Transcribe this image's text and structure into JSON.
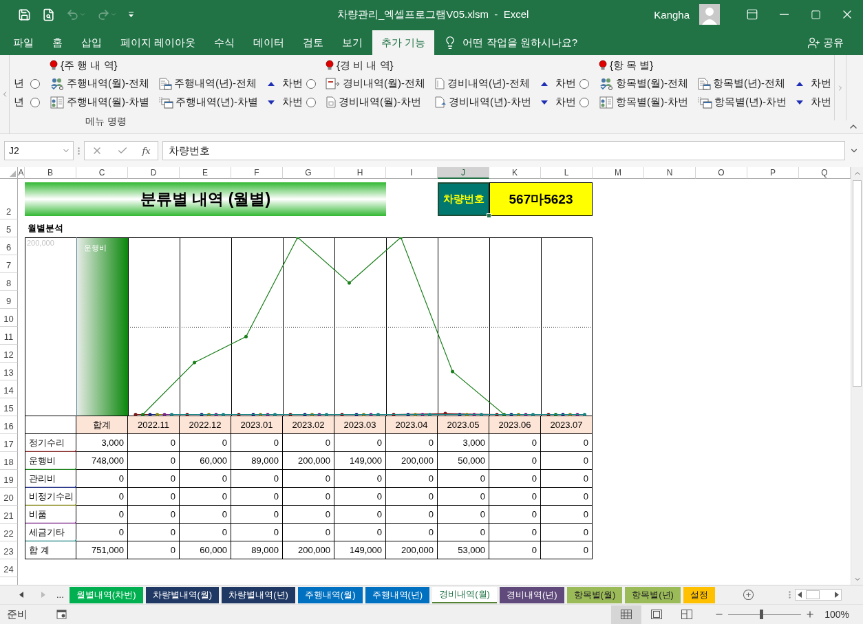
{
  "title_bar": {
    "quick_access": {
      "undo": {
        "disabled": true
      },
      "redo": {
        "disabled": true
      }
    },
    "title": "차량관리_엑셀프로그램V05.xlsm  -  Excel",
    "user": "Kangha"
  },
  "ribbon_tabs": [
    {
      "label": "파일",
      "selected": false
    },
    {
      "label": "홈",
      "selected": false
    },
    {
      "label": "삽입",
      "selected": false
    },
    {
      "label": "페이지 레이아웃",
      "selected": false
    },
    {
      "label": "수식",
      "selected": false
    },
    {
      "label": "데이터",
      "selected": false
    },
    {
      "label": "검토",
      "selected": false
    },
    {
      "label": "보기",
      "selected": false
    },
    {
      "label": "추가 기능",
      "selected": true
    }
  ],
  "tell_me": "어떤 작업을 원하시나요?",
  "share": "공유",
  "ribbon": {
    "cut_left_labels": [
      "년",
      "년"
    ],
    "groups": [
      {
        "header": "{주 행 내 역}",
        "rows": [
          [
            "주행내역(월)-전체",
            "주행내역(년)-전체",
            "차번"
          ],
          [
            "주행내역(월)-차별",
            "주행내역(년)-차별",
            "차번"
          ]
        ]
      },
      {
        "header": "{경 비 내 역}",
        "rows": [
          [
            "경비내역(월)-전체",
            "경비내역(년)-전체",
            "차번"
          ],
          [
            "경비내역(월)-차번",
            "경비내역(년)-차번",
            "차번"
          ]
        ]
      },
      {
        "header": "{항 목 별}",
        "rows": [
          [
            "항목별(월)-전체",
            "항목별(년)-전체",
            "차번"
          ],
          [
            "항목별(월)-차번",
            "항목별(년)-차번",
            "차번"
          ]
        ]
      }
    ],
    "group_label": "메뉴 명령"
  },
  "formula_bar": {
    "name_box": "J2",
    "function_label": "fx",
    "value": "차량번호"
  },
  "sheet": {
    "columns": [
      {
        "label": "A",
        "selected": false
      },
      {
        "label": "B",
        "selected": false
      },
      {
        "label": "C",
        "selected": false
      },
      {
        "label": "D",
        "selected": false
      },
      {
        "label": "E",
        "selected": false
      },
      {
        "label": "F",
        "selected": false
      },
      {
        "label": "G",
        "selected": false
      },
      {
        "label": "H",
        "selected": false
      },
      {
        "label": "I",
        "selected": false
      },
      {
        "label": "J",
        "selected": true
      },
      {
        "label": "K",
        "selected": false
      },
      {
        "label": "L",
        "selected": false
      },
      {
        "label": "M",
        "selected": false
      },
      {
        "label": "N",
        "selected": false
      },
      {
        "label": "O",
        "selected": false
      },
      {
        "label": "P",
        "selected": false
      },
      {
        "label": "Q",
        "selected": false
      }
    ],
    "rows": [
      "2",
      "5",
      "6",
      "7",
      "8",
      "9",
      "10",
      "11",
      "12",
      "13",
      "14",
      "15",
      "16",
      "17",
      "18",
      "19",
      "20",
      "21",
      "22",
      "23",
      "24"
    ],
    "title": "분류별 내역 (월별)",
    "vehicle_label": "차량번호",
    "vehicle_number": "567마5623",
    "section": "월별분석",
    "chart": {
      "highlight_label": "운행비",
      "axis_label": "200,000"
    },
    "table": {
      "total_header": "합계",
      "months": [
        "2022.11",
        "2022.12",
        "2023.01",
        "2023.02",
        "2023.03",
        "2023.04",
        "2023.05",
        "2023.06",
        "2023.07"
      ],
      "rows": [
        {
          "label": "정기수리",
          "color": "#7b1c1c",
          "total": "3,000",
          "values": [
            "0",
            "0",
            "0",
            "0",
            "0",
            "0",
            "3,000",
            "0",
            "0"
          ]
        },
        {
          "label": "운행비",
          "color": "#1a7f1a",
          "total": "748,000",
          "values": [
            "0",
            "60,000",
            "89,000",
            "200,000",
            "149,000",
            "200,000",
            "50,000",
            "0",
            "0"
          ]
        },
        {
          "label": "관리비",
          "color": "#1c2a80",
          "total": "0",
          "values": [
            "0",
            "0",
            "0",
            "0",
            "0",
            "0",
            "0",
            "0",
            "0"
          ]
        },
        {
          "label": "비정기수리",
          "color": "#8a8a20",
          "total": "0",
          "values": [
            "0",
            "0",
            "0",
            "0",
            "0",
            "0",
            "0",
            "0",
            "0"
          ]
        },
        {
          "label": "비품",
          "color": "#7d2a8a",
          "total": "0",
          "values": [
            "0",
            "0",
            "0",
            "0",
            "0",
            "0",
            "0",
            "0",
            "0"
          ]
        },
        {
          "label": "세금기타",
          "color": "#1f8585",
          "total": "0",
          "values": [
            "0",
            "0",
            "0",
            "0",
            "0",
            "0",
            "0",
            "0",
            "0"
          ]
        },
        {
          "label": "합 계",
          "total": "751,000",
          "values": [
            "0",
            "60,000",
            "89,000",
            "200,000",
            "149,000",
            "200,000",
            "53,000",
            "0",
            "0"
          ]
        }
      ]
    }
  },
  "sheet_tabs": {
    "more": "...",
    "tabs": [
      {
        "label": "월별내역(차번)",
        "color": "#00b050",
        "selected": false
      },
      {
        "label": "차량별내역(월)",
        "color": "#1f3864",
        "selected": false
      },
      {
        "label": "차량별내역(년)",
        "color": "#1f3864",
        "selected": false
      },
      {
        "label": "주행내역(월)",
        "color": "#0070c0",
        "selected": false
      },
      {
        "label": "주행내역(년)",
        "color": "#0070c0",
        "selected": false
      },
      {
        "label": "경비내역(월)",
        "color": "#548235",
        "selected": true
      },
      {
        "label": "경비내역(년)",
        "color": "#604a7b",
        "selected": false
      },
      {
        "label": "항목별(월)",
        "color": "#9bbb59",
        "selected": false
      },
      {
        "label": "항목별(년)",
        "color": "#9bbb59",
        "selected": false
      },
      {
        "label": "설정",
        "color": "#ffc000",
        "selected": false
      }
    ]
  },
  "status_bar": {
    "ready": "준비",
    "views": [
      {
        "selected": true
      },
      {
        "selected": false
      },
      {
        "selected": false
      }
    ],
    "zoom_slider": {
      "level": 0.45
    },
    "zoom": "100%"
  }
}
